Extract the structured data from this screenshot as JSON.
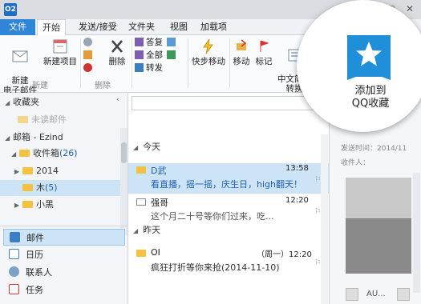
{
  "titlebar": {
    "app_icon": "O2",
    "minimize": "–",
    "maximize": "□",
    "close": "✕"
  },
  "tabs": [
    {
      "label": "文件"
    },
    {
      "label": "开始"
    },
    {
      "label": "发送/接受"
    },
    {
      "label": "文件夹"
    },
    {
      "label": "视图"
    },
    {
      "label": "加载项"
    }
  ],
  "ribbon": {
    "new_email": "新建\n电子邮件",
    "new_item": "新建项目",
    "group_new": "新建",
    "delete": "删除",
    "group_delete": "删除",
    "reply": "答复",
    "reply_all": "全部",
    "forward": "转发",
    "quick_move": "快步移动",
    "move": "移动",
    "tag": "标记",
    "chinese_convert": "中文简繁\n转换"
  },
  "overlay": {
    "line1": "添加到",
    "line2": "QQ收藏",
    "badge_color": "#1f8fd9",
    "badge_icon": "star-icon"
  },
  "left": {
    "favorites": "收藏夹",
    "unread": "未读邮件",
    "mailbox": "邮箱 - Ezind",
    "inbox_label": "收件箱",
    "inbox_count": "(26)",
    "y2014": "2014",
    "mu_label": "木",
    "mu_count": "(5)",
    "xiaohei": "小黑"
  },
  "nav": [
    {
      "label": "邮件"
    },
    {
      "label": "日历"
    },
    {
      "label": "联系人"
    },
    {
      "label": "任务"
    }
  ],
  "messages": {
    "today": "今天",
    "yesterday": "昨天",
    "items": [
      {
        "sender": "D武",
        "time": "13:58",
        "preview": "看直播，摇一摇，庆生日，high翻天！"
      },
      {
        "sender": "强哥",
        "time": "12:20",
        "preview": "这个月二十号等你们过来，吃..."
      },
      {
        "sender": "OI",
        "time": "（周一）12:20",
        "preview": "疯狂打折等你来抢(2014-11-10)"
      }
    ]
  },
  "reading": {
    "sent_time": "发送时间：2014/11",
    "recipients": "收件人：",
    "person": "AU..."
  },
  "colors": {
    "accent": "#2f86d6",
    "selected_row": "#cde4f7",
    "folder": "#f3c241",
    "link_count": "#1e5fb4"
  }
}
